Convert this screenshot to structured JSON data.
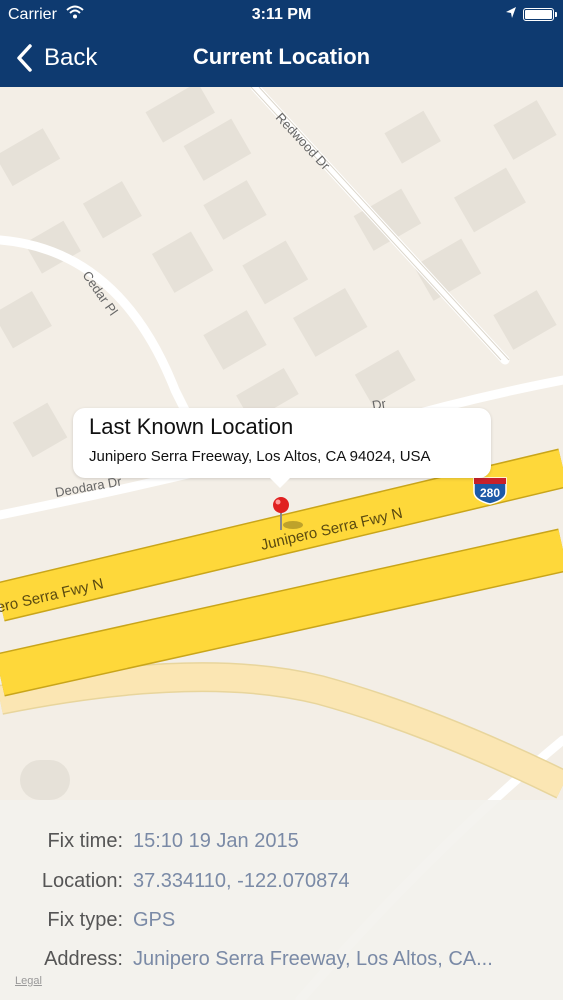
{
  "status_bar": {
    "carrier": "Carrier",
    "time": "3:11 PM",
    "icons": [
      "wifi-icon",
      "location-arrow-icon",
      "battery-icon"
    ]
  },
  "nav": {
    "back_label": "Back",
    "title": "Current Location"
  },
  "map": {
    "street_labels": {
      "redwood": "Redwood Dr",
      "cedar": "Cedar Pl",
      "deodara": "Deodara Dr",
      "dr_partial": "Dr",
      "freeway_1": "Junipero Serra Fwy N",
      "freeway_2": "Junipero Serra Fwy N"
    },
    "shield": "280",
    "callout": {
      "title": "Last Known Location",
      "subtitle": "Junipero Serra Freeway, Los Altos, CA 94024, USA"
    },
    "colors": {
      "land": "#f3eee6",
      "building": "#e6e1d8",
      "street": "#ffffff",
      "freeway": "#fed83a",
      "road_tan": "#fbe6b3",
      "pin": "#e02020"
    }
  },
  "info": {
    "rows": [
      {
        "label": "Fix time:",
        "value": "15:10 19 Jan 2015"
      },
      {
        "label": "Location:",
        "value": "37.334110, -122.070874"
      },
      {
        "label": "Fix type:",
        "value": "GPS"
      },
      {
        "label": "Address:",
        "value": "Junipero Serra Freeway, Los Altos, CA..."
      }
    ]
  },
  "legal": "Legal"
}
